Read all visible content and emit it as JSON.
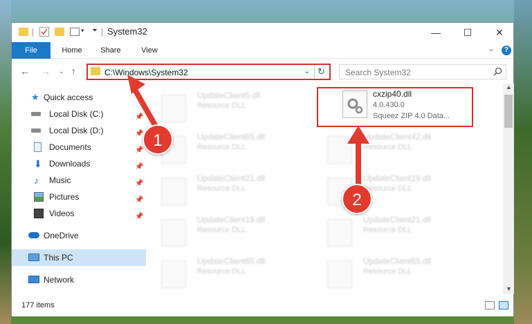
{
  "window": {
    "title": "System32",
    "minimize": "—",
    "maximize": "☐",
    "close": "✕"
  },
  "ribbon": {
    "tabs": [
      "File",
      "Home",
      "Share",
      "View"
    ],
    "help": "?",
    "expand": "⌄"
  },
  "address_bar": {
    "path": "C:\\Windows\\System32",
    "search_placeholder": "Search System32"
  },
  "sidebar": {
    "items": [
      {
        "label": "Quick access",
        "icon": "star-icon",
        "pinned": false
      },
      {
        "label": "Local Disk (C:)",
        "icon": "drive-icon",
        "pinned": true
      },
      {
        "label": "Local Disk (D:)",
        "icon": "drive-icon",
        "pinned": true
      },
      {
        "label": "Documents",
        "icon": "document-icon",
        "pinned": true
      },
      {
        "label": "Downloads",
        "icon": "download-icon",
        "pinned": true
      },
      {
        "label": "Music",
        "icon": "music-icon",
        "pinned": true
      },
      {
        "label": "Pictures",
        "icon": "picture-icon",
        "pinned": true
      },
      {
        "label": "Videos",
        "icon": "video-icon",
        "pinned": true
      },
      {
        "label": "OneDrive",
        "icon": "cloud-icon",
        "pinned": false
      },
      {
        "label": "This PC",
        "icon": "computer-icon",
        "pinned": false,
        "selected": true
      },
      {
        "label": "Network",
        "icon": "network-icon",
        "pinned": false
      }
    ]
  },
  "files": {
    "left_column": [
      {
        "name": "UpdateClient5.dll",
        "desc": "Resource DLL"
      },
      {
        "name": "UpdateClient65.dll",
        "desc": "Resource DLL"
      },
      {
        "name": "UpdateClient21.dll",
        "desc": "Resource DLL"
      },
      {
        "name": "UpdateClient19.dll",
        "desc": "Resource DLL"
      },
      {
        "name": "UpdateClient65.dll",
        "desc": "Resource DLL"
      }
    ],
    "right_column": [
      {
        "name": "cxzip40.dll",
        "version": "4.0.430.0",
        "desc": "Squeez ZIP 4.0 Data...",
        "selected": true
      },
      {
        "name": "UpdateClient42.dll",
        "desc": "Resource DLL"
      },
      {
        "name": "UpdateClient19.dll",
        "desc": "Resource DLL"
      },
      {
        "name": "UpdateClient21.dll",
        "desc": "Resource DLL"
      },
      {
        "name": "UpdateClient65.dll",
        "desc": "Resource DLL"
      }
    ]
  },
  "status": {
    "item_count": "177 items"
  },
  "annotations": {
    "marker1": "1",
    "marker2": "2"
  },
  "colors": {
    "accent": "#1979ca",
    "highlight": "#d32f2f",
    "marker": "#e23a2e"
  }
}
